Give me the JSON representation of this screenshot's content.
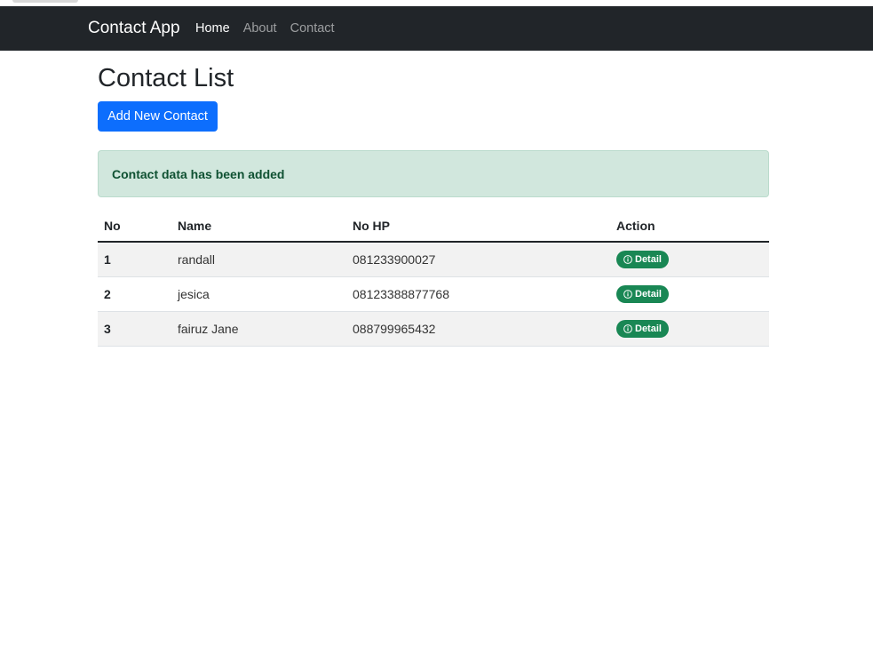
{
  "navbar": {
    "brand": "Contact App",
    "links": [
      {
        "label": "Home",
        "active": true
      },
      {
        "label": "About",
        "active": false
      },
      {
        "label": "Contact",
        "active": false
      }
    ]
  },
  "main": {
    "title": "Contact List",
    "add_button_label": "Add New Contact",
    "alert_message": "Contact data has been added"
  },
  "table": {
    "headers": [
      "No",
      "Name",
      "No HP",
      "Action"
    ],
    "rows": [
      {
        "no": "1",
        "name": "randall",
        "phone": "081233900027",
        "action": "Detail"
      },
      {
        "no": "2",
        "name": "jesica",
        "phone": "08123388877768",
        "action": "Detail"
      },
      {
        "no": "3",
        "name": "fairuz Jane",
        "phone": "088799965432",
        "action": "Detail"
      }
    ]
  },
  "icons": {
    "detail": "info-circle-icon"
  },
  "colors": {
    "navbar": "#212529",
    "primary": "#0d6efd",
    "success": "#198754",
    "alert_bg": "#d1e7dd",
    "alert_text": "#0f5132"
  }
}
